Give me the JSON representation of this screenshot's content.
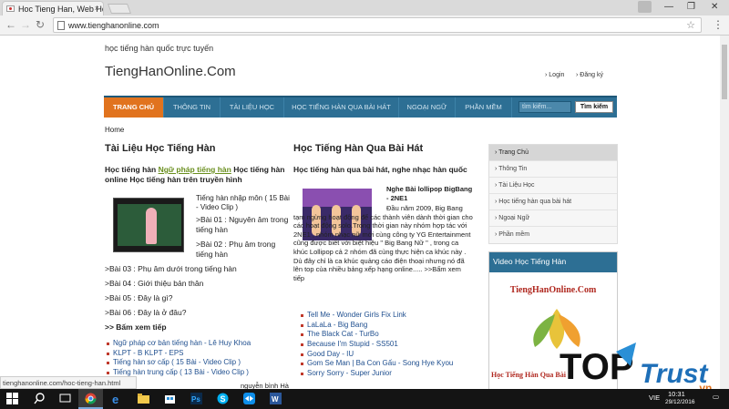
{
  "browser": {
    "tab_title": "Hoc Tieng Han, Web Hoc",
    "url": "www.tienghanonline.com",
    "status_url": "tienghanonline.com/hoc-tieng-han.html"
  },
  "site": {
    "tagline": "học tiếng hàn quốc trực tuyến",
    "title": "TiengHanOnline.Com",
    "login": "Login",
    "register": "Đăng ký",
    "breadcrumb": "Home",
    "nav": [
      "TRANG CHỦ",
      "THÔNG TIN",
      "TÀI LIỆU HỌC",
      "HỌC TIẾNG HÀN QUA BÀI HÁT",
      "NGOẠI NGỮ",
      "PHẦN MỀM"
    ],
    "search_placeholder": "tìm kiếm...",
    "search_button": "Tìm kiếm"
  },
  "left": {
    "heading": "Tài Liệu Học Tiếng Hàn",
    "intro_1": "Học tiếng hàn ",
    "intro_link": "Ngữ pháp tiếng hàn",
    "intro_2": " Học tiếng hàn online Học tiếng hàn trên truyền hình",
    "video_title": "Tiếng hàn nhập môn ( 15 Bài - Video Clip )",
    "b1": ">Bài 01 : Nguyên âm trong tiếng hàn",
    "b2": ">Bài 02 : Phụ âm trong tiếng hàn",
    "b3": ">Bài 03 : Phụ âm dưới trong tiếng hàn",
    "b4": ">Bài 04 : Giới thiệu bản thân",
    "b5": ">Bài 05 : Đây là gì?",
    "b6": ">Bài 06 : Đây là ở đâu?",
    "more": ">> Bấm xem tiếp",
    "links": [
      "Ngữ pháp cơ bản tiếng hàn - Lê Huy Khoa",
      "KLPT - B KLPT - EPS",
      "Tiếng hàn sơ cấp ( 15 Bài - Video Clip )",
      "Tiếng hàn trung cấp ( 13 Bài - Video Clip )"
    ],
    "partial_text": "nguyễn bình Hà"
  },
  "middle": {
    "heading": "Học Tiếng Hàn Qua Bài Hát",
    "subheading": "Học tiếng hàn qua bài hát, nghe nhạc hàn quốc",
    "song_title": "Nghe Bài lollipop BigBang - 2NE1",
    "song_desc": "Đầu năm 2009, Big Bang tạm ngừng hoạt động để các thành viên dành thời gian cho các hoạt động solo.Trong thời gian này nhóm hợp tác với 2NE1 , nhóm nhạc nữ mới cùng công ty YG Entertainment cũng được biết với biệt hiệu \" Big Bang Nữ \" , trong ca khúc Lollipop cả 2 nhóm đã cùng thực hiện ca khúc này . Dù đây chỉ là ca khúc quảng cáo điện thoại nhưng nó đã lên top của nhiều bảng xếp hạng online..... >>Bấm xem tiếp",
    "songs": [
      "Tell Me - Wonder Girls Fix Link",
      "LaLaLa - Big Bang",
      "The Black Cat - TurBo",
      "Because I'm Stupid - SS501",
      "Good Day - IU",
      "Gom Se Man | Ba Con Gấu - Song Hye Kyou",
      "Sorry Sorry - Super Junior"
    ]
  },
  "sidebar": {
    "items": [
      "Trang Chủ",
      "Thông Tin",
      "Tài Liệu Học",
      "Học tiếng hàn qua bài hát",
      "Ngoại Ngữ",
      "Phần mềm"
    ],
    "video_heading": "Video Học Tiếng Hàn",
    "video_logo": "TiengHanOnline.Com",
    "video_foot": "Học Tiếng Hàn Qua Bài"
  },
  "watermark": {
    "text_top": "TOP",
    "text_right": "Trust",
    "suffix": ".vn"
  },
  "taskbar": {
    "lang": "VIE",
    "time": "10:31",
    "date": "29/12/2016"
  },
  "colors": {
    "nav_bg": "#2d6f94",
    "nav_active": "#e1731e",
    "link": "#1f4f8f"
  }
}
